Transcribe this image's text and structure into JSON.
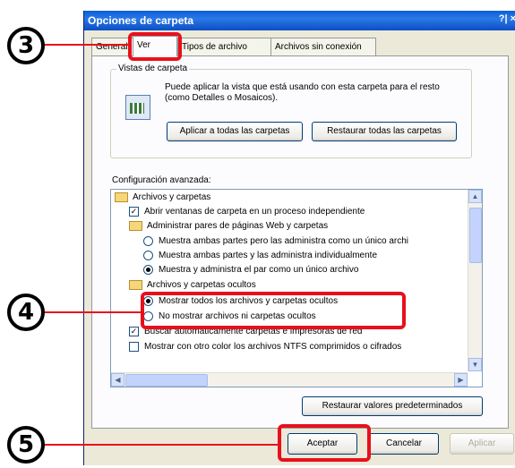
{
  "window": {
    "title": "Opciones de carpeta",
    "title_buttons": "?| ×"
  },
  "tabs": [
    {
      "label": "General"
    },
    {
      "label": "Ver"
    },
    {
      "label": "Tipos de archivo"
    },
    {
      "label": "Archivos sin conexión"
    }
  ],
  "vistas": {
    "legend": "Vistas de carpeta",
    "description": "Puede aplicar la vista que está usando con esta carpeta para el resto (como Detalles o Mosaicos).",
    "apply_all": "Aplicar a todas las carpetas",
    "reset_all": "Restaurar todas las carpetas"
  },
  "advanced": {
    "label": "Configuración avanzada:",
    "items": [
      {
        "type": "folder",
        "label": "Archivos y carpetas"
      },
      {
        "type": "check",
        "checked": true,
        "label": "Abrir ventanas de carpeta en un proceso independiente"
      },
      {
        "type": "folder",
        "label": "Administrar pares de páginas Web y carpetas"
      },
      {
        "type": "radio",
        "checked": false,
        "label": "Muestra ambas partes pero las administra como un único archi"
      },
      {
        "type": "radio",
        "checked": false,
        "label": "Muestra ambas partes y las administra individualmente"
      },
      {
        "type": "radio",
        "checked": true,
        "label": "Muestra y administra el par como un único archivo"
      },
      {
        "type": "folder",
        "label": "Archivos y carpetas ocultos"
      },
      {
        "type": "radio",
        "checked": true,
        "label": "Mostrar todos los archivos y carpetas ocultos"
      },
      {
        "type": "radio",
        "checked": false,
        "label": "No mostrar archivos ni carpetas ocultos"
      },
      {
        "type": "check",
        "checked": true,
        "label": "Buscar automáticamente carpetas e impresoras de red"
      },
      {
        "type": "check",
        "checked": false,
        "label": "Mostrar con otro color los archivos NTFS comprimidos o cifrados"
      }
    ]
  },
  "buttons": {
    "restore_defaults": "Restaurar valores predeterminados",
    "ok": "Aceptar",
    "cancel": "Cancelar",
    "apply": "Aplicar"
  },
  "callouts": {
    "c3": "3",
    "c4": "4",
    "c5": "5"
  },
  "colors": {
    "highlight": "#e8101c",
    "titlebar": "#0a5fd8"
  }
}
